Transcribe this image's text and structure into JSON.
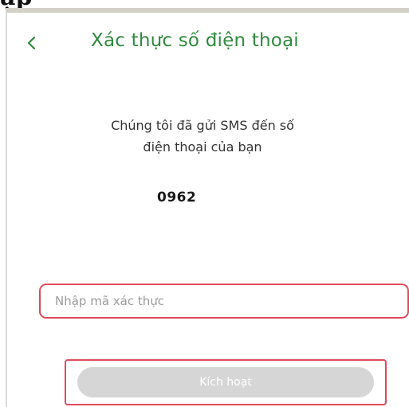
{
  "heading_fragment": "ập",
  "header": {
    "back_icon": "chevron-left-icon",
    "title": "Xác thực số điện thoại",
    "accent_color": "#2e8b3c"
  },
  "message": {
    "line1": "Chúng tôi đã gửi SMS đến số",
    "line2": "điện thoại của bạn"
  },
  "phone_number": "0962",
  "code_input": {
    "placeholder": "Nhập mã xác thực",
    "value": ""
  },
  "activate_button": {
    "label": "Kích hoạt",
    "state": "disabled"
  },
  "highlight_color": "#e04a5a"
}
